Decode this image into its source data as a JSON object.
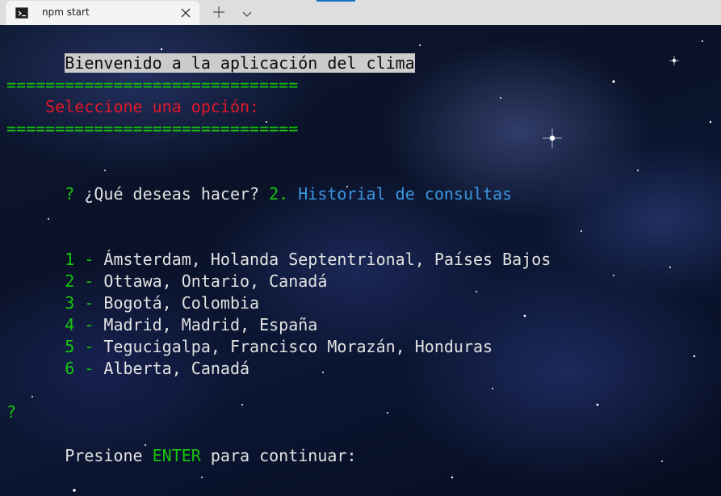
{
  "tab": {
    "title": "npm start",
    "icon": "terminal-icon"
  },
  "colors": {
    "green": "#16c60c",
    "red": "#e0192a",
    "blue": "#3a96dd",
    "text": "#e2e2e2",
    "highlight": "#cccccc"
  },
  "terminal": {
    "welcome": "Bienvenido a la aplicación del clima",
    "separator": "==============================",
    "menu_title": "    Seleccione una opción:",
    "prompt": {
      "mark": "?",
      "question": " ¿Qué deseas hacer? ",
      "choice_number": "2.",
      "choice_label": " Historial de consultas"
    },
    "history": [
      {
        "number": "1",
        "dash": " - ",
        "place": "Ámsterdam, Holanda Septentrional, Países Bajos"
      },
      {
        "number": "2",
        "dash": " - ",
        "place": "Ottawa, Ontario, Canadá"
      },
      {
        "number": "3",
        "dash": " - ",
        "place": "Bogotá, Colombia"
      },
      {
        "number": "4",
        "dash": " - ",
        "place": "Madrid, Madrid, España"
      },
      {
        "number": "5",
        "dash": " - ",
        "place": "Tegucigalpa, Francisco Morazán, Honduras"
      },
      {
        "number": "6",
        "dash": " - ",
        "place": "Alberta, Canadá"
      }
    ],
    "continue": {
      "mark": "?",
      "before": "Presione ",
      "key": "ENTER",
      "after": " para continuar:"
    }
  }
}
